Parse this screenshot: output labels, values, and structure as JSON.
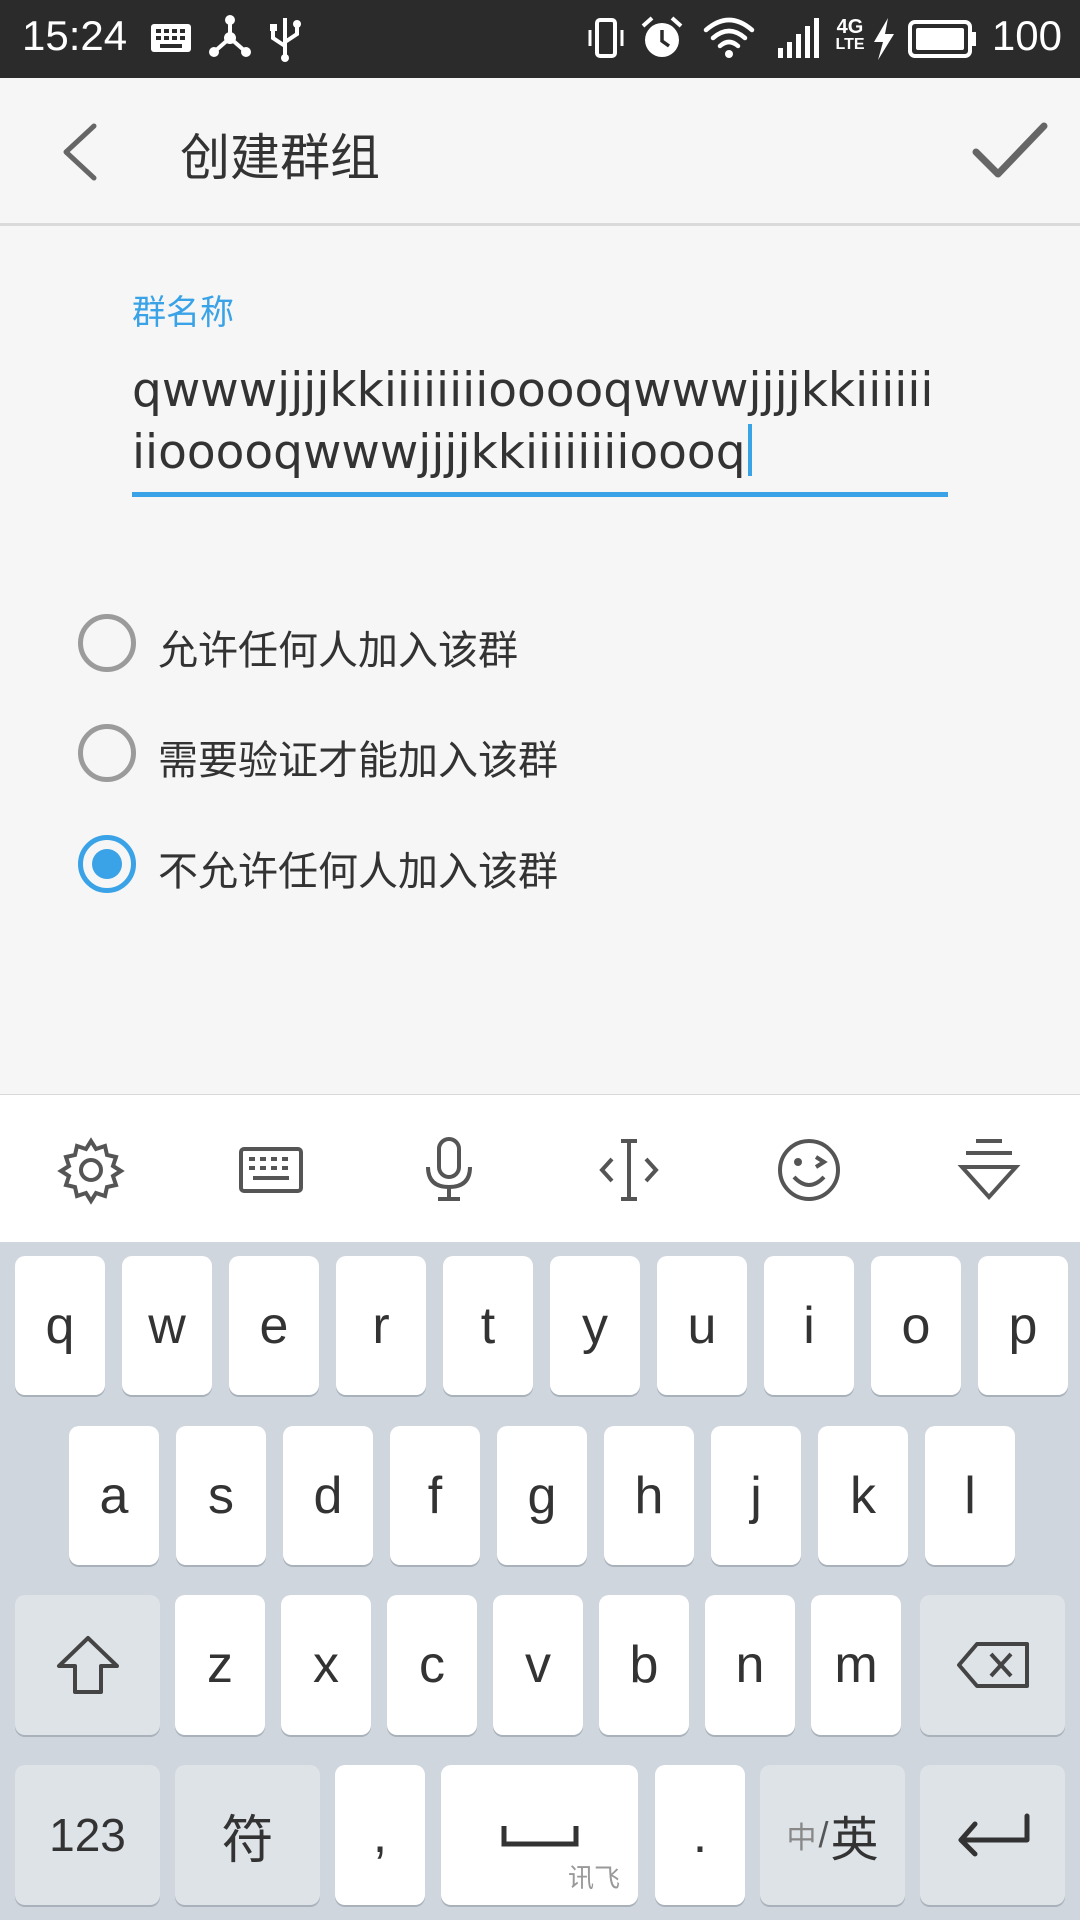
{
  "status_bar": {
    "time": "15:24",
    "battery": "100",
    "icons": [
      "keyboard-icon",
      "share-icon",
      "usb-icon",
      "vibrate-icon",
      "alarm-icon",
      "wifi-icon",
      "signal-icon",
      "4g-lte-icon",
      "charging-icon",
      "battery-icon"
    ],
    "network_4g": "4G",
    "network_lte": "LTE"
  },
  "app_bar": {
    "title": "创建群组",
    "back_icon": "chevron-left-icon",
    "confirm_icon": "check-icon"
  },
  "form": {
    "group_name_label": "群名称",
    "group_name_value": "qwwwjjjjkkiiiiiiiioooo qwwwjjjjkkiiiiiiiioooo qwwwjjjjkkiiiiiiiioooo q",
    "line1": "qwwwjjjjkkiiiiiiiiooooqwwwjjjjkkiiiiii",
    "line2": "iiooooqwwwjjjjkkiiiiiiiioooq",
    "accent_color": "#3aa2e6",
    "options": [
      {
        "label": "允许任何人加入该群",
        "checked": false
      },
      {
        "label": "需要验证才能加入该群",
        "checked": false
      },
      {
        "label": "不允许任何人加入该群",
        "checked": true
      }
    ]
  },
  "keyboard": {
    "toolbar": [
      "gear-icon",
      "keyboard-icon",
      "microphone-icon",
      "cursor-icon",
      "emoji-icon",
      "collapse-icon"
    ],
    "row1": [
      "q",
      "w",
      "e",
      "r",
      "t",
      "y",
      "u",
      "i",
      "o",
      "p"
    ],
    "row2": [
      "a",
      "s",
      "d",
      "f",
      "g",
      "h",
      "j",
      "k",
      "l"
    ],
    "row3": [
      "z",
      "x",
      "c",
      "v",
      "b",
      "n",
      "m"
    ],
    "shift_icon": "shift-icon",
    "backspace_icon": "backspace-icon",
    "num_label": "123",
    "symbol_label": "符",
    "comma_label": ",",
    "space_icon": "space-icon",
    "space_brand": "讯飞",
    "period_label": ".",
    "lang_zh": "中",
    "lang_sep": "/",
    "lang_en": "英",
    "enter_icon": "enter-icon"
  }
}
